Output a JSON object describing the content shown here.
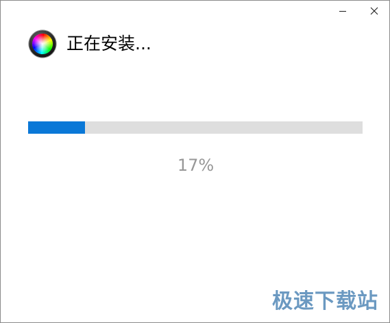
{
  "window": {
    "minimize_label": "Minimize",
    "close_label": "Close"
  },
  "header": {
    "title": "正在安装...",
    "icon": "color-wheel-icon"
  },
  "progress": {
    "value": 0.17,
    "percent_label": "17%",
    "fill_color": "#0a78d7",
    "track_color": "#dedede"
  },
  "watermark": {
    "text": "极速下载站"
  }
}
